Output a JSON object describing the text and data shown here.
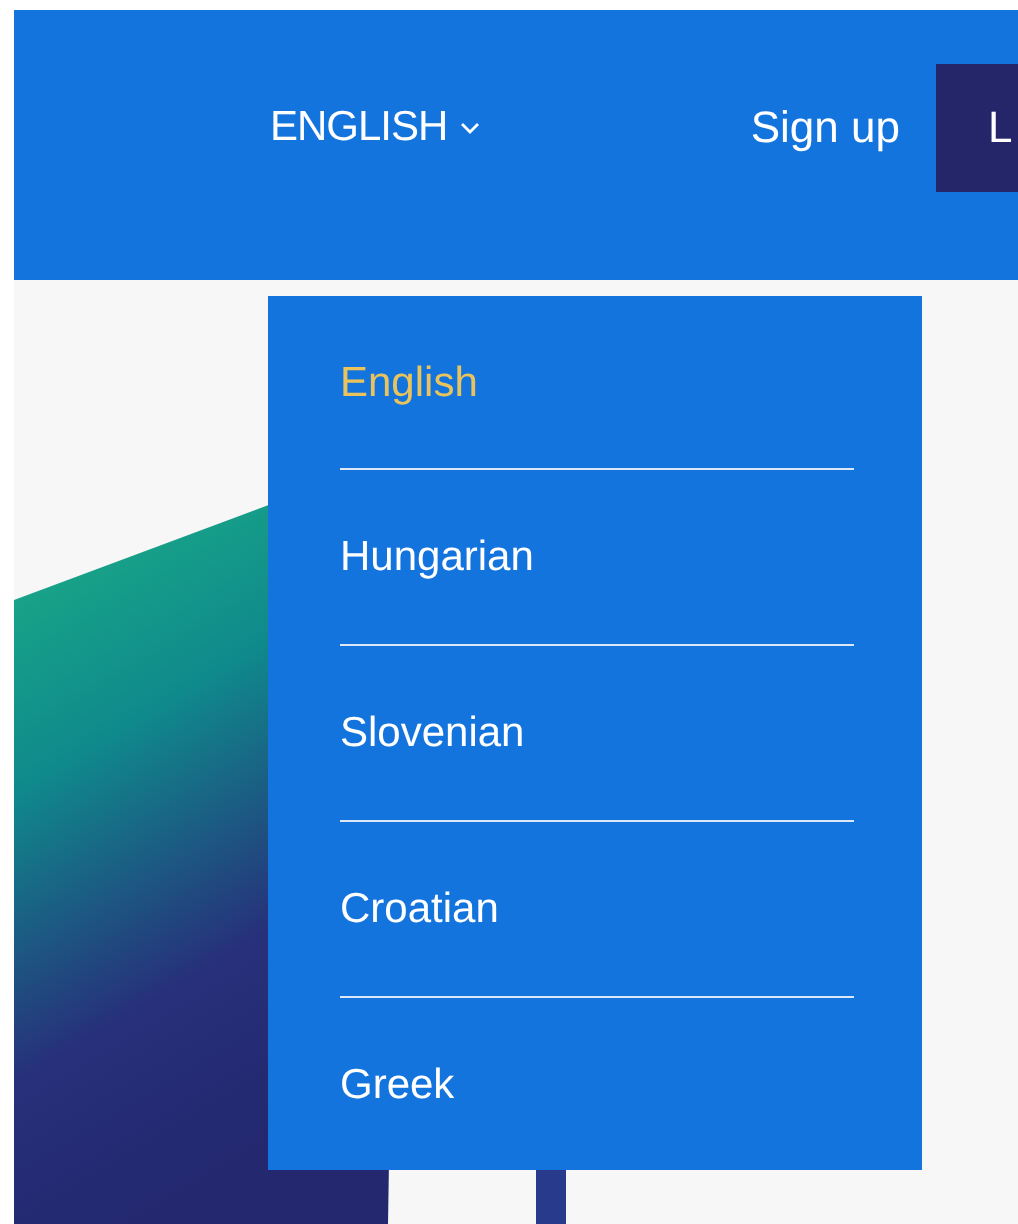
{
  "header": {
    "language_button": {
      "label": "ENGLISH",
      "expanded": true
    },
    "sign_up_link": "Sign up",
    "login_button": "L"
  },
  "language_menu": [
    {
      "label": "English",
      "selected": true
    },
    {
      "label": "Hungarian",
      "selected": false
    },
    {
      "label": "Slovenian",
      "selected": false
    },
    {
      "label": "Croatian",
      "selected": false
    },
    {
      "label": "Greek",
      "selected": false
    }
  ]
}
